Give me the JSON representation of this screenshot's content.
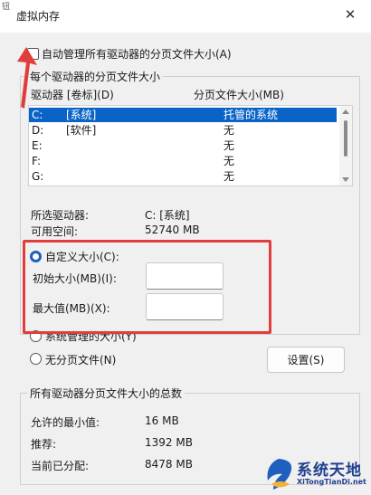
{
  "window": {
    "title": "虚拟内存",
    "close_glyph": "✕",
    "corner_glyph": "钮"
  },
  "auto_manage": {
    "label": "自动管理所有驱动器的分页文件大小(A)",
    "checked": false
  },
  "group_drive": {
    "title": "每个驱动器的分页文件大小",
    "col_drive": "驱动器 [卷标](D)",
    "col_paging": "分页文件大小(MB)",
    "rows": [
      {
        "drive": "C:",
        "label": "[系统]",
        "size": "托管的系统",
        "selected": true
      },
      {
        "drive": "D:",
        "label": "[软件]",
        "size": "无",
        "selected": false
      },
      {
        "drive": "E:",
        "label": "",
        "size": "无",
        "selected": false
      },
      {
        "drive": "F:",
        "label": "",
        "size": "无",
        "selected": false
      },
      {
        "drive": "G:",
        "label": "",
        "size": "无",
        "selected": false
      }
    ],
    "selected_drive_label": "所选驱动器:",
    "selected_drive_value": "C:  [系统]",
    "free_space_label": "可用空间:",
    "free_space_value": "52740 MB"
  },
  "options": {
    "custom_size_label": "自定义大小(C):",
    "initial_size_label": "初始大小(MB)(I):",
    "initial_size_value": "",
    "max_size_label": "最大值(MB)(X):",
    "max_size_value": "",
    "system_managed_label": "系统管理的大小(Y)",
    "no_paging_label": "无分页文件(N)",
    "set_button": "设置(S)"
  },
  "group_total": {
    "title": "所有驱动器分页文件大小的总数",
    "min_label": "允许的最小值:",
    "min_value": "16 MB",
    "recommended_label": "推荐:",
    "recommended_value": "1392 MB",
    "allocated_label": "当前已分配:",
    "allocated_value": "8478 MB"
  },
  "watermark": {
    "title": "系统天地",
    "subtitle": "XiTongTianDi.net",
    "accent": "#1f3f8f"
  },
  "annotation_color": "#e23d3d"
}
